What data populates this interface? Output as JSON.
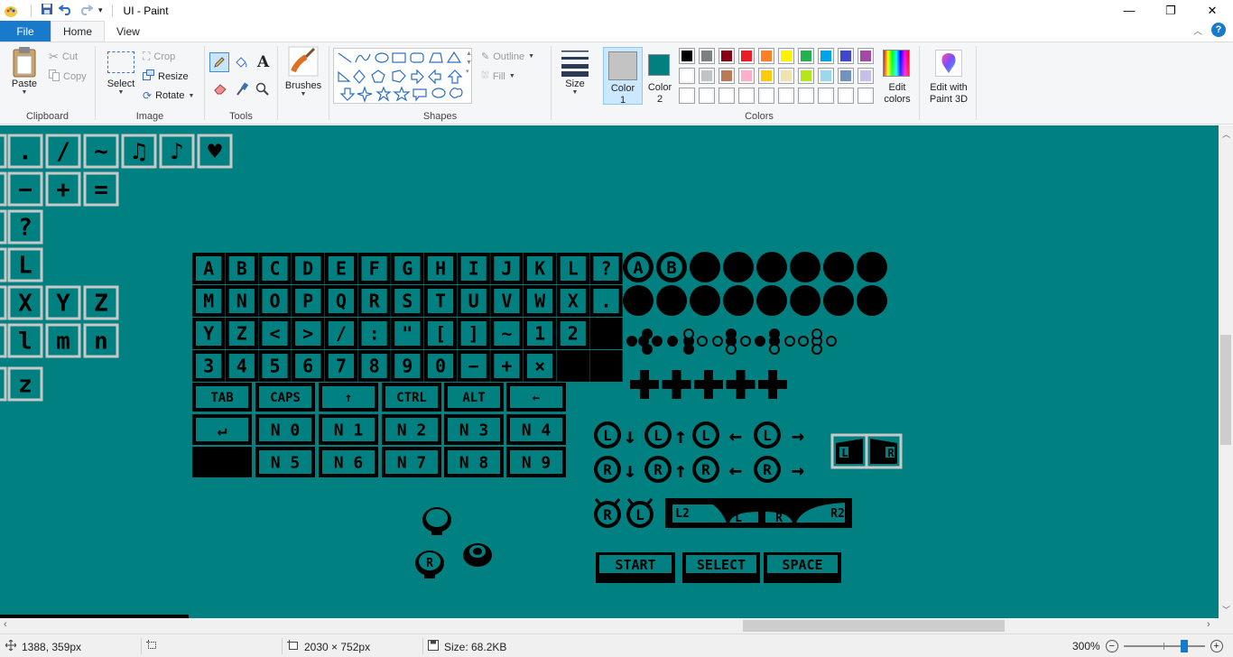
{
  "window": {
    "title": "UI - Paint",
    "controls": {
      "minimize": "—",
      "maximize": "❐",
      "close": "✕"
    }
  },
  "tabs": [
    {
      "label": "File"
    },
    {
      "label": "Home"
    },
    {
      "label": "View"
    }
  ],
  "ribbon": {
    "clipboard": {
      "label": "Clipboard",
      "paste": "Paste",
      "cut": "Cut",
      "copy": "Copy"
    },
    "image": {
      "label": "Image",
      "select": "Select",
      "crop": "Crop",
      "resize": "Resize",
      "rotate": "Rotate"
    },
    "tools": {
      "label": "Tools",
      "text_tool": "A"
    },
    "brushes": {
      "label": "Brushes"
    },
    "shapes": {
      "label": "Shapes",
      "outline": "Outline",
      "fill": "Fill"
    },
    "size": {
      "label": "Size"
    },
    "colors": {
      "label": "Colors",
      "color1": {
        "line1": "Color",
        "line2": "1",
        "value": "#c3c3c3"
      },
      "color2": {
        "line1": "Color",
        "line2": "2",
        "value": "#008080"
      },
      "edit_colors": {
        "line1": "Edit",
        "line2": "colors"
      },
      "palette_row1": [
        "#000000",
        "#7f7f7f",
        "#880015",
        "#ed1c24",
        "#ff7f27",
        "#fff200",
        "#22b14c",
        "#00a2e8",
        "#3f48cc",
        "#a349a4"
      ],
      "palette_row2": [
        "#ffffff",
        "#c3c3c3",
        "#b97a57",
        "#ffaec9",
        "#ffc90e",
        "#efe4b0",
        "#b5e61d",
        "#99d9ea",
        "#7092be",
        "#c8bfe7"
      ],
      "palette_row3": [
        "#ffffff",
        "#ffffff",
        "#ffffff",
        "#ffffff",
        "#ffffff",
        "#ffffff",
        "#ffffff",
        "#ffffff",
        "#ffffff",
        "#ffffff"
      ]
    },
    "paint3d": {
      "line1": "Edit with",
      "line2": "Paint 3D"
    }
  },
  "canvas": {
    "background": "#008080",
    "left_glyphs": [
      ".",
      "/",
      "~",
      "♫",
      "♪",
      "♥",
      "−",
      "+",
      "=",
      "?",
      "L",
      "X",
      "Y",
      "Z",
      "l",
      "m",
      "n",
      "z"
    ],
    "keyboard_rows": [
      [
        "A",
        "B",
        "C",
        "D",
        "E",
        "F",
        "G",
        "H",
        "I",
        "J",
        "K",
        "L",
        "?"
      ],
      [
        "M",
        "N",
        "O",
        "P",
        "Q",
        "R",
        "S",
        "T",
        "U",
        "V",
        "W",
        "X",
        "."
      ],
      [
        "Y",
        "Z",
        "<",
        ">",
        "/",
        ":",
        "\"",
        "[",
        "]",
        "~",
        "1",
        "2",
        ""
      ],
      [
        "3",
        "4",
        "5",
        "6",
        "7",
        "8",
        "9",
        "0",
        "−",
        "+",
        "×",
        "",
        ""
      ]
    ],
    "special_keys": [
      "TAB",
      "CAPS",
      "↑",
      "CTRL",
      "ALT",
      "←"
    ],
    "numpad_row1": [
      "↵",
      "N 0",
      "N 1",
      "N 2",
      "N 3",
      "N 4"
    ],
    "numpad_row2": [
      "",
      "N 5",
      "N 6",
      "N 7",
      "N 8",
      "N 9"
    ],
    "face_buttons": [
      "A",
      "B"
    ],
    "stick_rows": [
      [
        "L",
        "↓",
        "L",
        "↑",
        "L",
        "←",
        "L",
        "→"
      ],
      [
        "R",
        "↓",
        "R",
        "↑",
        "R",
        "←",
        "R",
        "→"
      ]
    ],
    "shoulder_labels": [
      "L",
      "R",
      "L2",
      "L",
      "R",
      "R2"
    ],
    "stick_click": [
      "R",
      "L"
    ],
    "small_sticks": [
      "R"
    ],
    "menu_buttons": [
      "START",
      "SELECT",
      "SPACE"
    ]
  },
  "statusbar": {
    "cursor": "1388, 359px",
    "dimensions": "2030 × 752px",
    "size": "Size: 68.2KB",
    "zoom": "300%",
    "zoom_level_percent": 300
  }
}
